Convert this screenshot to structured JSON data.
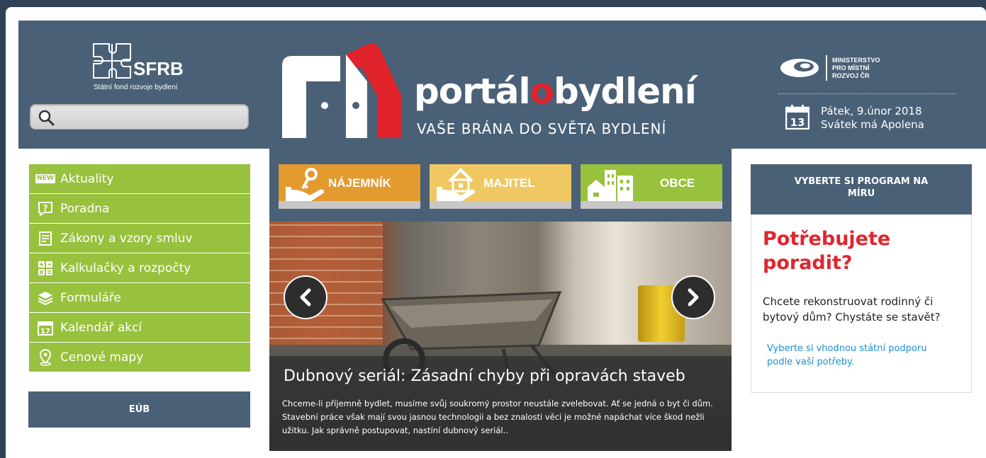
{
  "sfrb": {
    "name": "SFRB",
    "subtitle": "Státní fond rozvoje bydlení"
  },
  "search": {
    "placeholder": ""
  },
  "logo": {
    "word_before": "portál",
    "word_o": "o",
    "word_after": "bydlení",
    "tagline": "VAŠE BRÁNA DO SVĚTA BYDLENÍ"
  },
  "ministry": {
    "text": "MINISTERSTVO\nPRO MÍSTNÍ\nROZVOJ ČR"
  },
  "date": {
    "line1": "Pátek, 9.únor 2018",
    "line2": "Svátek má Apolena",
    "day": "13"
  },
  "menu": [
    {
      "label": "Aktuality",
      "badge": "NEW",
      "icon": "new-badge-icon"
    },
    {
      "label": "Poradna",
      "icon": "question-icon"
    },
    {
      "label": "Zákony a vzory smluv",
      "icon": "document-icon"
    },
    {
      "label": "Kalkulačky a rozpočty",
      "icon": "calculator-icon"
    },
    {
      "label": "Formuláře",
      "icon": "layers-icon"
    },
    {
      "label": "Kalendář akcí",
      "icon": "calendar-icon",
      "day": "17"
    },
    {
      "label": "Cenové mapy",
      "icon": "map-pin-icon"
    }
  ],
  "eub": {
    "label": "EÚB"
  },
  "tiles": [
    {
      "label": "NÁJEMNÍK",
      "color": "#e39a2f"
    },
    {
      "label": "MAJITEL",
      "color": "#f0c862"
    },
    {
      "label": "OBCE",
      "color": "#98c13d"
    }
  ],
  "slider": {
    "title": "Dubnový seriál: Zásadní chyby při opravách staveb",
    "text": "Chceme-li příjemně bydlet, musíme svůj soukromý prostor neustále zvelebovat. Ať se jedná o byt či dům. Stavební práce však mají svou jasnou technologii a bez znalosti věci je možné napáchat více škod nežli užitku. Jak správně postupovat, nastíní dubnový seriál.."
  },
  "program": {
    "heading": "VYBERTE SI PROGRAM NA MÍRU",
    "title": "Potřebujete poradit?",
    "text": "Chcete rekonstruovat rodinný či bytový dům? Chystáte se stavět?",
    "link": "Vyberte si vhodnou státní podporu podle vaší potřeby."
  },
  "colors": {
    "header": "#4a6076",
    "menu": "#98c13d",
    "accent_red": "#e1232b",
    "link": "#1a8fd0"
  }
}
